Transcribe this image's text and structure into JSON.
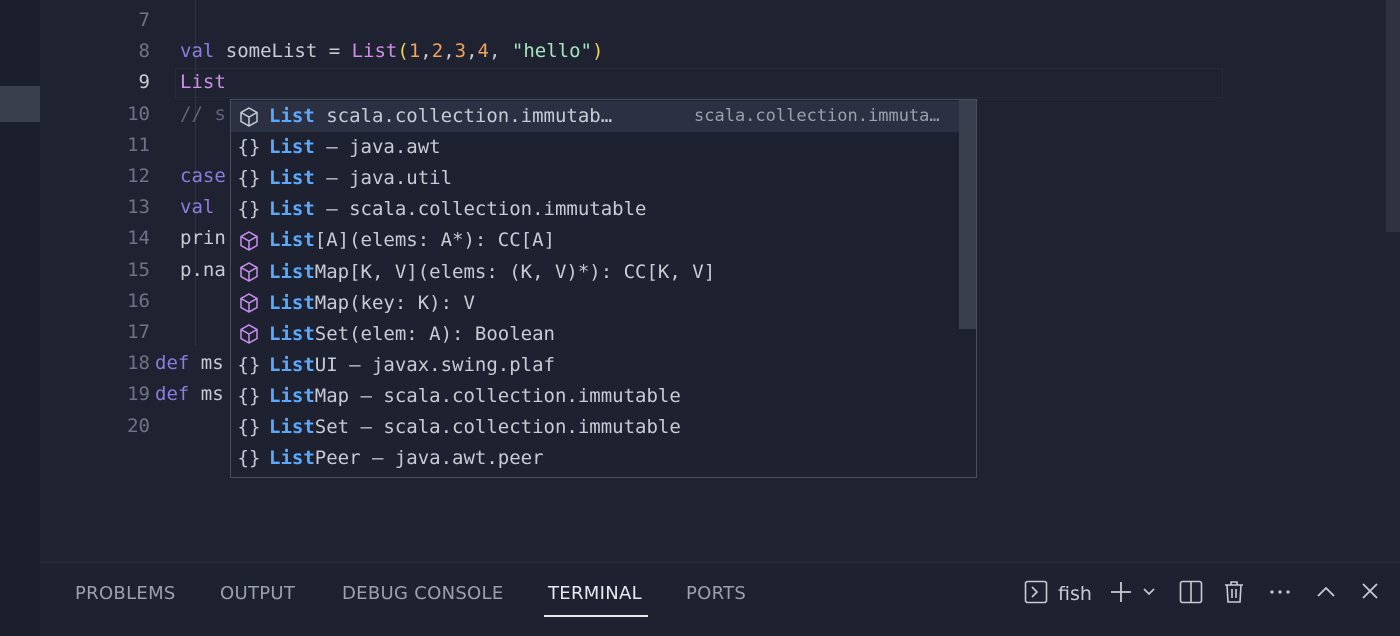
{
  "editor": {
    "lines": [
      {
        "n": "7",
        "parts": []
      },
      {
        "n": "8",
        "parts": [
          [
            "kw",
            "val"
          ],
          [
            "p",
            " someList = "
          ],
          [
            "typ",
            "List"
          ],
          [
            "paren",
            "("
          ],
          [
            "num",
            "1"
          ],
          [
            "p",
            ","
          ],
          [
            "num",
            "2"
          ],
          [
            "p",
            ","
          ],
          [
            "num",
            "3"
          ],
          [
            "p",
            ","
          ],
          [
            "num",
            "4"
          ],
          [
            "p",
            ", "
          ],
          [
            "str",
            "\"hello\""
          ],
          [
            "paren",
            ")"
          ]
        ]
      },
      {
        "n": "9",
        "parts": [
          [
            "typ",
            "List"
          ]
        ]
      },
      {
        "n": "10",
        "parts": [
          [
            "cmt",
            "// s"
          ]
        ]
      },
      {
        "n": "11",
        "parts": []
      },
      {
        "n": "12",
        "parts": [
          [
            "kw",
            "case"
          ]
        ]
      },
      {
        "n": "13",
        "parts": [
          [
            "kw",
            "val"
          ]
        ]
      },
      {
        "n": "14",
        "parts": [
          [
            "p",
            "prin"
          ]
        ]
      },
      {
        "n": "15",
        "parts": [
          [
            "p",
            "p.na"
          ]
        ]
      },
      {
        "n": "16",
        "parts": []
      },
      {
        "n": "17",
        "parts": []
      },
      {
        "n": "18",
        "parts": [
          [
            "kw",
            "def"
          ],
          [
            "p",
            " ms"
          ]
        ]
      },
      {
        "n": "19",
        "parts": [
          [
            "kw",
            "def"
          ],
          [
            "p",
            " ms"
          ]
        ]
      },
      {
        "n": "20",
        "parts": []
      }
    ]
  },
  "suggest": {
    "items": [
      {
        "icon": "cube",
        "match": "List",
        "rest": " scala.collection.immutab…",
        "detail": "scala.collection.immuta…"
      },
      {
        "icon": "braces",
        "match": "List",
        "rest": " – java.awt",
        "detail": ""
      },
      {
        "icon": "braces",
        "match": "List",
        "rest": " – java.util",
        "detail": ""
      },
      {
        "icon": "braces",
        "match": "List",
        "rest": " – scala.collection.immutable",
        "detail": ""
      },
      {
        "icon": "method",
        "match": "List",
        "rest": "[A](elems: A*): CC[A]",
        "detail": ""
      },
      {
        "icon": "method",
        "match": "List",
        "rest": "Map[K, V](elems: (K, V)*): CC[K, V]",
        "detail": ""
      },
      {
        "icon": "method",
        "match": "List",
        "rest": "Map(key: K): V",
        "detail": ""
      },
      {
        "icon": "method",
        "match": "List",
        "rest": "Set(elem: A): Boolean",
        "detail": ""
      },
      {
        "icon": "braces",
        "match": "List",
        "rest": "UI – javax.swing.plaf",
        "detail": ""
      },
      {
        "icon": "braces",
        "match": "List",
        "rest": "Map – scala.collection.immutable",
        "detail": ""
      },
      {
        "icon": "braces",
        "match": "List",
        "rest": "Set – scala.collection.immutable",
        "detail": ""
      },
      {
        "icon": "braces",
        "match": "List",
        "rest": "Peer – java.awt.peer",
        "detail": ""
      }
    ]
  },
  "panel": {
    "tabs": [
      "PROBLEMS",
      "OUTPUT",
      "DEBUG CONSOLE",
      "TERMINAL",
      "PORTS"
    ],
    "active_tab": "TERMINAL",
    "terminal_name": "fish"
  },
  "icons": {
    "suggest_class": "cube-icon",
    "suggest_module": "braces-icon",
    "suggest_method": "method-cube-icon",
    "terminal": "terminal-icon",
    "new_terminal": "plus-icon",
    "dropdown": "chevron-down-icon",
    "split": "split-icon",
    "delete": "trash-icon",
    "more": "ellipsis-icon",
    "maximize": "chevron-up-icon",
    "close": "close-icon"
  },
  "colors": {
    "background": "#1f2331",
    "keyword": "#8c7ce0",
    "type": "#cf8ee8",
    "number": "#f0a35c",
    "string": "#a7e4bd",
    "match": "#5aa9ff"
  }
}
